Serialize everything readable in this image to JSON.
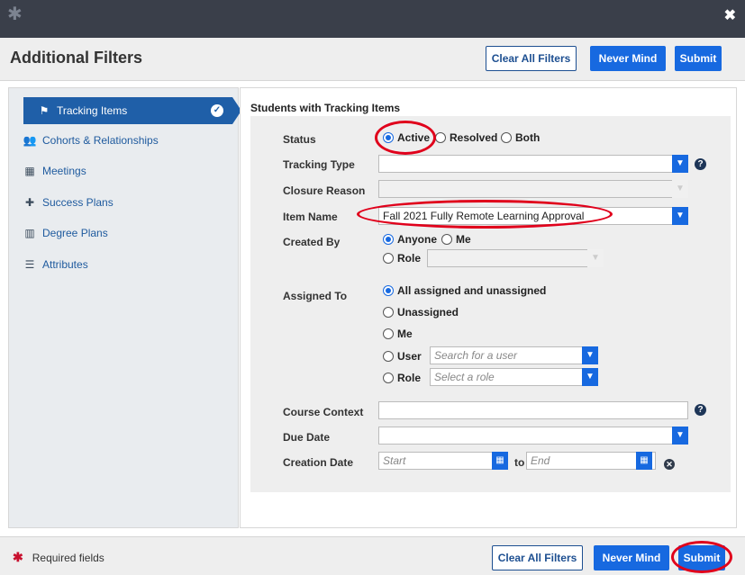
{
  "titlebar": {
    "logo_icon": "star-logo-icon",
    "close_icon": "close-icon",
    "close_glyph": "✖"
  },
  "header": {
    "title": "Additional Filters",
    "clear_label": "Clear All Filters",
    "never_mind_label": "Never Mind",
    "submit_label": "Submit"
  },
  "sidebar": {
    "items": [
      {
        "label": "Tracking Items",
        "icon": "flag-icon",
        "active": true
      },
      {
        "label": "Cohorts & Relationships",
        "icon": "users-icon"
      },
      {
        "label": "Meetings",
        "icon": "calendar-icon"
      },
      {
        "label": "Success Plans",
        "icon": "puzzle-icon"
      },
      {
        "label": "Degree Plans",
        "icon": "map-icon"
      },
      {
        "label": "Attributes",
        "icon": "sliders-icon"
      }
    ]
  },
  "main": {
    "heading": "Students with Tracking Items",
    "status": {
      "label": "Status",
      "options": [
        "Active",
        "Resolved",
        "Both"
      ],
      "selected": "Active"
    },
    "tracking_type": {
      "label": "Tracking Type",
      "value": ""
    },
    "closure_reason": {
      "label": "Closure Reason",
      "value": ""
    },
    "item_name": {
      "label": "Item Name",
      "value": "Fall 2021 Fully Remote Learning Approval"
    },
    "created_by": {
      "label": "Created By",
      "options": [
        "Anyone",
        "Me",
        "Role"
      ],
      "selected": "Anyone",
      "role_value": ""
    },
    "assigned_to": {
      "label": "Assigned To",
      "options": [
        "All assigned and unassigned",
        "Unassigned",
        "Me",
        "User",
        "Role"
      ],
      "selected": "All assigned and unassigned",
      "user_placeholder": "Search for a user",
      "role_placeholder": "Select a role"
    },
    "course_context": {
      "label": "Course Context",
      "value": ""
    },
    "due_date": {
      "label": "Due Date",
      "value": ""
    },
    "creation_date": {
      "label": "Creation Date",
      "start_placeholder": "Start",
      "to_label": "to",
      "end_placeholder": "End"
    }
  },
  "footer": {
    "required_label": "Required fields",
    "clear_label": "Clear All Filters",
    "never_mind_label": "Never Mind",
    "submit_label": "Submit"
  },
  "colors": {
    "primary": "#1769e0",
    "nav_active": "#1f5fa8",
    "highlight": "#e0001b",
    "titlebar": "#3a3f4a"
  }
}
